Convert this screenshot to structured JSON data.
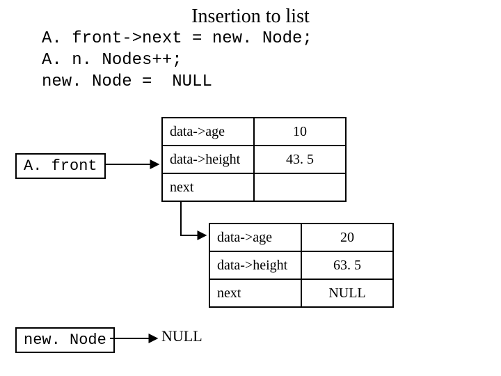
{
  "title": "Insertion to list",
  "code": "A. front->next = new. Node;\nA. n. Nodes++;\nnew. Node =  NULL",
  "labels": {
    "afront": "A. front",
    "newnode": "new. Node",
    "null": "NULL"
  },
  "node1": {
    "r1k": "data->age",
    "r1v": "10",
    "r2k": "data->height",
    "r2v": "43. 5",
    "r3k": "next",
    "r3v": ""
  },
  "node2": {
    "r1k": "data->age",
    "r1v": "20",
    "r2k": "data->height",
    "r2v": "63. 5",
    "r3k": "next",
    "r3v": "NULL"
  }
}
